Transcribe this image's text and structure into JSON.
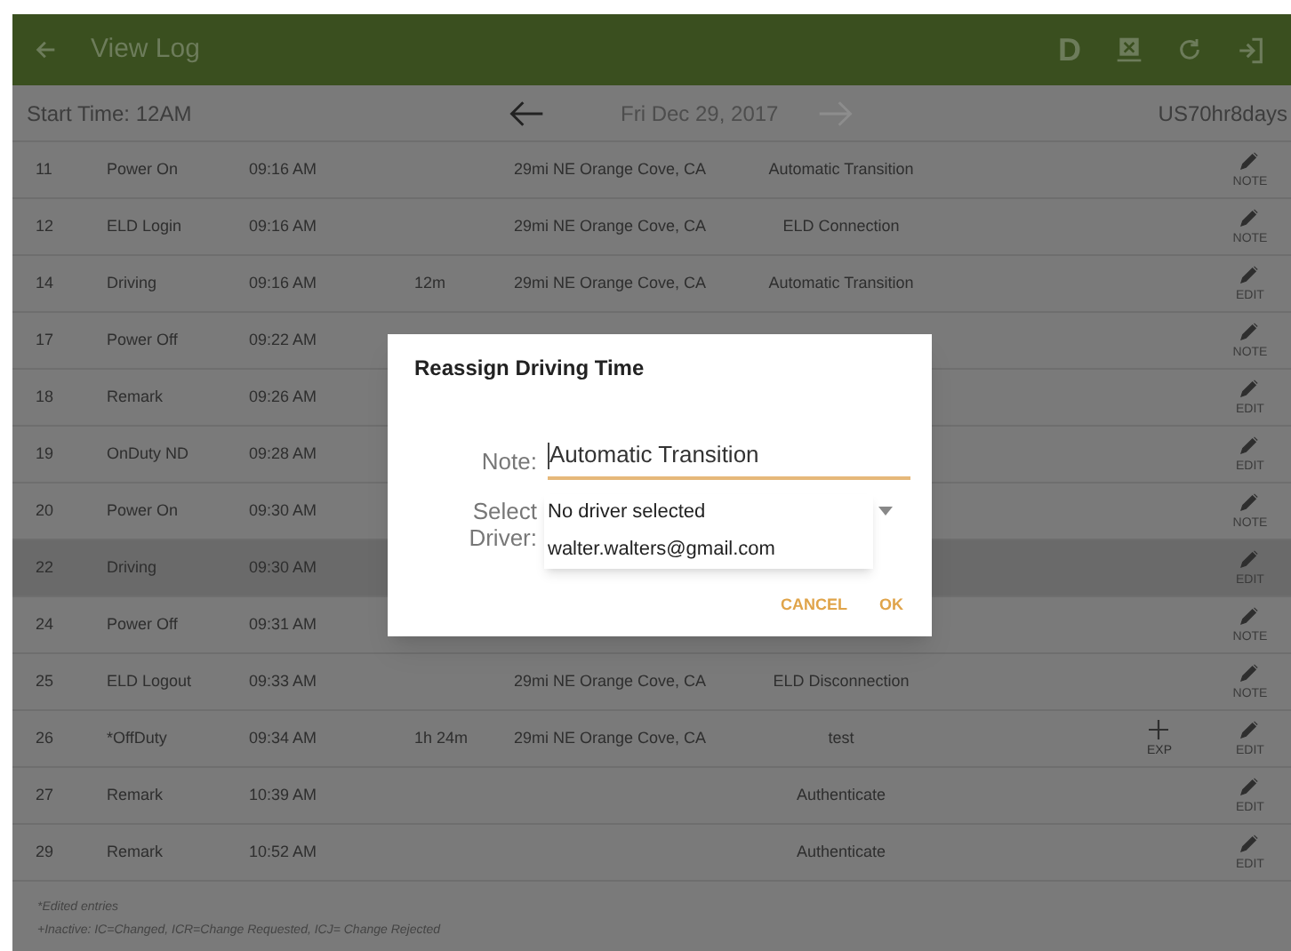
{
  "app_bar": {
    "title": "View Log",
    "letter_action": "D"
  },
  "date_bar": {
    "start_time": "Start Time: 12AM",
    "date": "Fri Dec 29, 2017",
    "rule_set": "US70hr8days",
    "prev_enabled": true,
    "next_enabled": false
  },
  "rows": [
    {
      "number": "11",
      "event": "Power On",
      "time": "09:16 AM",
      "location": "29mi NE Orange Cove, CA",
      "origin": "Automatic Transition",
      "action": "NOTE",
      "selected": false
    },
    {
      "number": "12",
      "event": "ELD Login",
      "time": "09:16 AM",
      "location": "29mi NE Orange Cove, CA",
      "origin": "ELD Connection",
      "action": "NOTE",
      "selected": false
    },
    {
      "number": "14",
      "event": "Driving",
      "time": "09:16 AM",
      "duration": "12m",
      "location": "29mi NE Orange Cove, CA",
      "origin": "Automatic Transition",
      "action": "EDIT",
      "selected": false
    },
    {
      "number": "17",
      "event": "Power Off",
      "time": "09:22 AM",
      "action": "NOTE",
      "selected": false
    },
    {
      "number": "18",
      "event": "Remark",
      "time": "09:26 AM",
      "action": "EDIT",
      "selected": false
    },
    {
      "number": "19",
      "event": "OnDuty ND",
      "time": "09:28 AM",
      "action": "EDIT",
      "selected": false
    },
    {
      "number": "20",
      "event": "Power On",
      "time": "09:30 AM",
      "action": "NOTE",
      "selected": false
    },
    {
      "number": "22",
      "event": "Driving",
      "time": "09:30 AM",
      "action": "EDIT",
      "selected": true
    },
    {
      "number": "24",
      "event": "Power Off",
      "time": "09:31 AM",
      "action": "NOTE",
      "selected": false
    },
    {
      "number": "25",
      "event": "ELD Logout",
      "time": "09:33 AM",
      "location": "29mi NE Orange Cove, CA",
      "origin": "ELD Disconnection",
      "action": "NOTE",
      "selected": false
    },
    {
      "number": "26",
      "event": "*OffDuty",
      "time": "09:34 AM",
      "duration": "1h 24m",
      "location": "29mi NE Orange Cove, CA",
      "origin": "test",
      "exp": "EXP",
      "action": "EDIT",
      "selected": false
    },
    {
      "number": "27",
      "event": "Remark",
      "time": "10:39 AM",
      "origin": "Authenticate",
      "action": "EDIT",
      "selected": false
    },
    {
      "number": "29",
      "event": "Remark",
      "time": "10:52 AM",
      "origin": "Authenticate",
      "action": "EDIT",
      "selected": false
    }
  ],
  "footer": [
    "*Edited entries",
    "+Inactive: IC=Changed, ICR=Change Requested, ICJ= Change Rejected"
  ],
  "dialog": {
    "title": "Reassign Driving Time",
    "note_label": "Note:",
    "note_value": "Automatic Transition",
    "driver_label": "Select Driver:",
    "options": [
      "No driver selected",
      "walter.walters@gmail.com"
    ],
    "buttons": [
      "CANCEL",
      "OK"
    ]
  }
}
